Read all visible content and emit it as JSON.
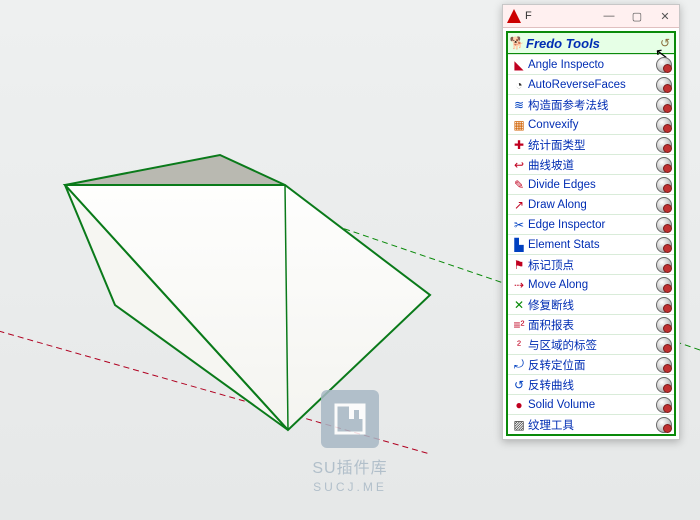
{
  "window": {
    "title_letter": "F",
    "buttons": {
      "min": "—",
      "max": "▢",
      "close": "✕"
    }
  },
  "toolbar": {
    "title": "Fredo Tools",
    "header_icon": "🐕",
    "gear": "↺",
    "items": [
      {
        "icon": "◣",
        "icon_cls": "ic-red",
        "label": "Angle Inspecto"
      },
      {
        "icon": "◔",
        "icon_cls": "ic-dark",
        "label": "AutoReverseFaces"
      },
      {
        "icon": "≋",
        "icon_cls": "ic-blue",
        "label": "构造面参考法线"
      },
      {
        "icon": "▦",
        "icon_cls": "ic-orange",
        "label": "Convexify"
      },
      {
        "icon": "✚",
        "icon_cls": "ic-red",
        "label": "统计面类型"
      },
      {
        "icon": "↩",
        "icon_cls": "ic-red",
        "label": "曲线坡道"
      },
      {
        "icon": "✎",
        "icon_cls": "ic-red",
        "label": "Divide Edges"
      },
      {
        "icon": "↗",
        "icon_cls": "ic-red",
        "label": "Draw Along"
      },
      {
        "icon": "✂",
        "icon_cls": "ic-blue",
        "label": "Edge Inspector"
      },
      {
        "icon": "▙",
        "icon_cls": "ic-blue",
        "label": "Element Stats"
      },
      {
        "icon": "⚑",
        "icon_cls": "ic-red",
        "label": "标记顶点"
      },
      {
        "icon": "⇢",
        "icon_cls": "ic-red",
        "label": "Move Along"
      },
      {
        "icon": "✕",
        "icon_cls": "ic-green",
        "label": "修复断线"
      },
      {
        "icon": "≡²",
        "icon_cls": "ic-red",
        "label": "面积报表"
      },
      {
        "icon": "²",
        "icon_cls": "ic-red",
        "label": "与区域的标签"
      },
      {
        "icon": "⤾",
        "icon_cls": "ic-blue",
        "label": "反转定位面"
      },
      {
        "icon": "↺",
        "icon_cls": "ic-blue",
        "label": "反转曲线"
      },
      {
        "icon": "●",
        "icon_cls": "ic-red",
        "label": "Solid Volume"
      },
      {
        "icon": "▨",
        "icon_cls": "ic-dark",
        "label": "纹理工具"
      }
    ]
  },
  "watermark": {
    "line1": "SU插件库",
    "line2": "SUCJ.ME"
  },
  "colors": {
    "edge": "#0a7a1a",
    "face_light": "#fdfdfb",
    "face_dark": "#b9b9b1",
    "axis_red": "#b00020",
    "axis_green": "#0a8a0a",
    "bg_top": "#eef0f0",
    "bg_bottom": "#e6e8e8"
  }
}
